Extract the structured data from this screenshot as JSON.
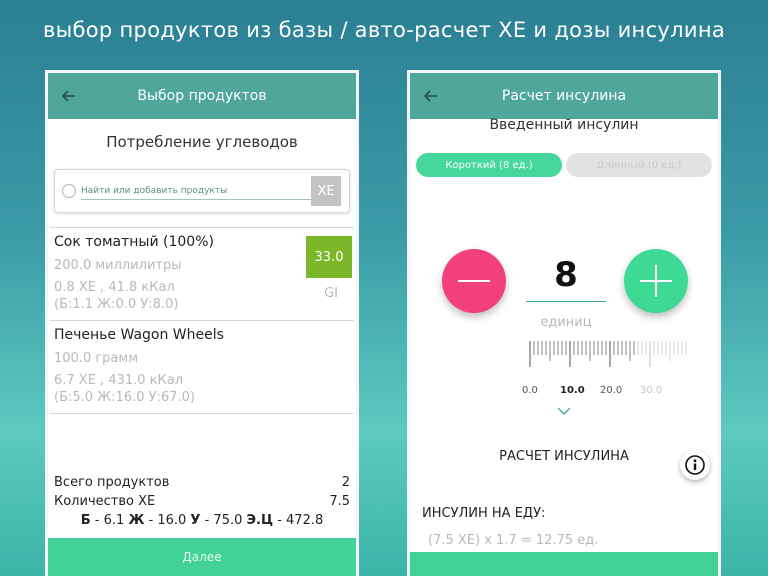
{
  "headline": "выбор продуктов из базы / авто-расчет ХЕ и дозы инсулина",
  "colors": {
    "appbar": "#4fa79c",
    "accent_green": "#42d298",
    "minus_pink": "#f1407a",
    "plus_green": "#3fd996",
    "gi_green": "#7ab82a"
  },
  "left_screen": {
    "appbar_title": "Выбор продуктов",
    "back_icon": "arrow-left-icon",
    "section_title": "Потребление углеводов",
    "search": {
      "placeholder": "Найти или добавить продукты",
      "xe_button": "ХЕ"
    },
    "foods": [
      {
        "name": "Сок томатный (100%)",
        "amount": "200.0 миллилитры",
        "summary": "0.8 ХЕ , 41.8 кКал",
        "macros": "(Б:1.1 Ж:0.0 У:8.0)",
        "gi_value": "33.0",
        "gi_label": "GI"
      },
      {
        "name": "Печенье Wagon Wheels",
        "amount": "100.0 грамм",
        "summary": "6.7 ХЕ , 431.0 кКал",
        "macros": "(Б:5.0 Ж:16.0 У:67.0)"
      }
    ],
    "totals": {
      "products_label": "Всего продуктов",
      "products_value": "2",
      "xe_label": "Количество ХЕ",
      "xe_value": "7.5",
      "b_label": "Б",
      "b_value": "- 6.1",
      "zh_label": "Ж",
      "zh_value": "- 16.0",
      "u_label": "У",
      "u_value": "- 75.0",
      "ec_label": "Э.Ц",
      "ec_value": "- 472.8"
    },
    "next_button": "Далее"
  },
  "right_screen": {
    "appbar_title": "Расчет инсулина",
    "back_icon": "arrow-left-icon",
    "section_title": "Введенный инсулин",
    "tabs": [
      {
        "label": "Короткий (8 ед.)",
        "active": true
      },
      {
        "label": "Длинный (0 ед.)",
        "active": false
      }
    ],
    "dose_value": "8",
    "dose_unit": "единиц",
    "ruler_labels": [
      "0.0",
      "10.0",
      "20.0",
      "30.0"
    ],
    "calc_title": "РАСЧЕТ ИНСУЛИНА",
    "info_icon": "info-icon",
    "food_insulin_label": "ИНСУЛИН НА ЕДУ:",
    "food_insulin_calc": "(7.5 ХЕ) x 1.7 = 12.75 ед."
  }
}
